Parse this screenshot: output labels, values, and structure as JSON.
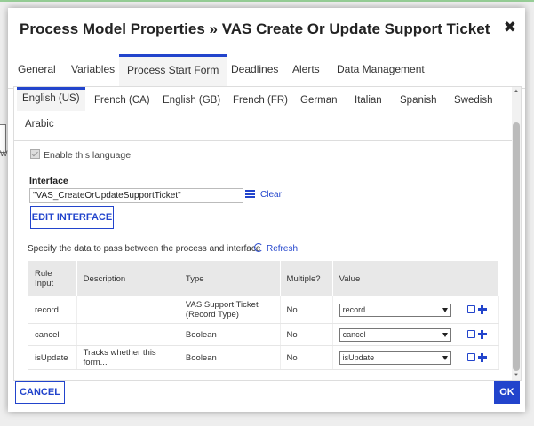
{
  "dialog": {
    "title": "Process Model Properties » VAS Create Or Update Support Ticket",
    "close_glyph": "✖"
  },
  "main_tabs": [
    {
      "label": "General"
    },
    {
      "label": "Variables"
    },
    {
      "label": "Process Start Form",
      "active": true
    },
    {
      "label": "Deadlines"
    },
    {
      "label": "Alerts"
    },
    {
      "label": "Data Management"
    }
  ],
  "language_tabs": [
    {
      "label": "English (US)",
      "active": true
    },
    {
      "label": "French (CA)"
    },
    {
      "label": "English (GB)"
    },
    {
      "label": "French (FR)"
    },
    {
      "label": "German"
    },
    {
      "label": "Italian"
    },
    {
      "label": "Spanish"
    },
    {
      "label": "Swedish"
    },
    {
      "label": "Arabic"
    }
  ],
  "enable_language": {
    "label": "Enable this language",
    "checked": true
  },
  "interface": {
    "label": "Interface",
    "value": "\"VAS_CreateOrUpdateSupportTicket\"",
    "clear_label": "Clear",
    "edit_button": "EDIT INTERFACE"
  },
  "data_pass": {
    "instruction": "Specify the data to pass between the process and interface",
    "refresh_label": "Refresh"
  },
  "table": {
    "headers": [
      "Rule Input",
      "Description",
      "Type",
      "Multiple?",
      "Value"
    ],
    "rows": [
      {
        "rule_input": "record",
        "description": "",
        "type": "VAS Support Ticket (Record Type)",
        "multiple": "No",
        "value": "record"
      },
      {
        "rule_input": "cancel",
        "description": "",
        "type": "Boolean",
        "multiple": "No",
        "value": "cancel"
      },
      {
        "rule_input": "isUpdate",
        "description": "Tracks whether this form...",
        "type": "Boolean",
        "multiple": "No",
        "value": "isUpdate"
      }
    ]
  },
  "footer": {
    "cancel_label": "CANCEL",
    "ok_label": "OK"
  },
  "background": {
    "stub_label": "W"
  },
  "colors": {
    "accent": "#2244cc",
    "tab_active_bg": "#f4f4f4",
    "header_bg": "#e8e8e8"
  }
}
